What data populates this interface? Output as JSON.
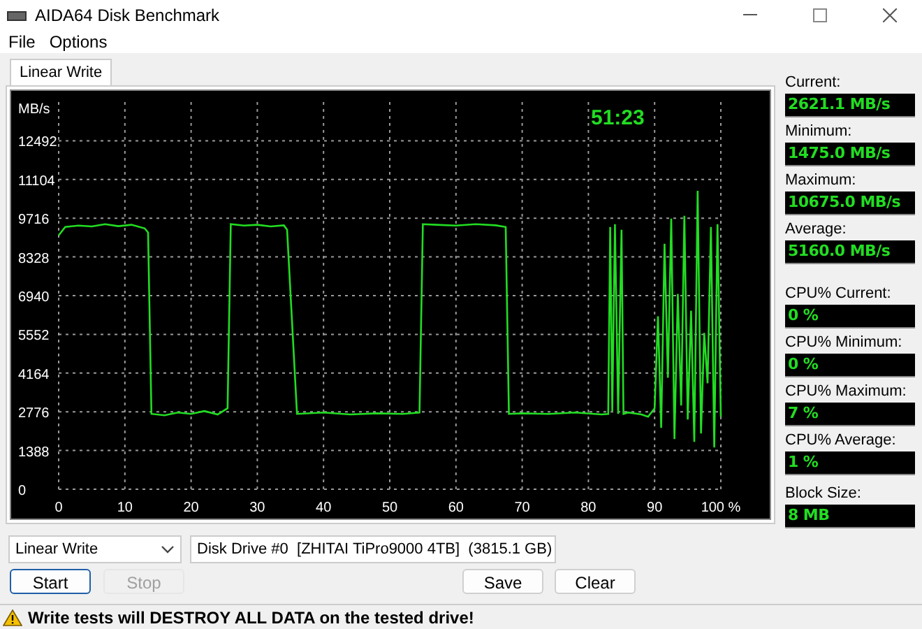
{
  "window": {
    "title": "AIDA64 Disk Benchmark"
  },
  "menu": [
    "File",
    "Options"
  ],
  "tabs": [
    {
      "label": "Linear Write",
      "selected": true
    }
  ],
  "chart": {
    "elapsed": "51:23",
    "chart_data": {
      "type": "line",
      "grid": true,
      "ylabel": "MB/s",
      "xlim": [
        0,
        100
      ],
      "ylim": [
        0,
        13880
      ],
      "xticks": [
        0,
        10,
        20,
        30,
        40,
        50,
        60,
        70,
        80,
        90,
        {
          "value": 100,
          "label": "100 %"
        }
      ],
      "yticks": [
        0,
        1388,
        2776,
        4164,
        5552,
        6940,
        8328,
        9716,
        11104,
        12492
      ],
      "x": [
        0,
        1,
        3,
        5,
        7,
        9,
        11,
        13,
        13.5,
        14,
        16,
        18,
        20,
        22,
        24,
        25.5,
        26,
        28,
        30,
        32,
        34,
        34.5,
        36,
        40,
        44,
        48,
        52,
        54.5,
        55,
        57,
        60,
        63,
        66,
        67.5,
        68,
        70,
        74,
        78,
        82,
        83,
        83.3,
        83.6,
        84,
        84.5,
        85,
        85.3,
        86,
        88,
        89,
        90,
        90.5,
        91,
        91.5,
        92,
        92.5,
        93,
        93.5,
        94,
        94.5,
        95,
        95.5,
        96,
        96.5,
        97,
        97.5,
        98,
        98.5,
        99,
        99.5,
        100
      ],
      "series": [
        {
          "color": "#22dd22",
          "values": [
            9100,
            9400,
            9450,
            9420,
            9500,
            9430,
            9480,
            9350,
            9200,
            2700,
            2650,
            2750,
            2700,
            2800,
            2680,
            2900,
            9500,
            9450,
            9480,
            9420,
            9460,
            9300,
            2700,
            2750,
            2680,
            2720,
            2700,
            2750,
            9500,
            9480,
            9450,
            9500,
            9460,
            9400,
            2700,
            2720,
            2700,
            2750,
            2680,
            2700,
            9400,
            2800,
            9500,
            2700,
            9300,
            2700,
            2750,
            2680,
            2600,
            2900,
            6200,
            2200,
            8800,
            4000,
            9700,
            1800,
            7000,
            3000,
            9800,
            2500,
            6400,
            1700,
            10700,
            2000,
            5600,
            3800,
            9400,
            1500,
            9500,
            2600
          ]
        }
      ]
    }
  },
  "stats": [
    {
      "label": "Current:",
      "value": "2621.1 MB/s"
    },
    {
      "label": "Minimum:",
      "value": "1475.0 MB/s"
    },
    {
      "label": "Maximum:",
      "value": "10675.0 MB/s"
    },
    {
      "label": "Average:",
      "value": "5160.0 MB/s"
    },
    {
      "label": "CPU% Current:",
      "value": "0 %"
    },
    {
      "label": "CPU% Minimum:",
      "value": "0 %"
    },
    {
      "label": "CPU% Maximum:",
      "value": "7 %"
    },
    {
      "label": "CPU% Average:",
      "value": "1 %"
    },
    {
      "label": "Block Size:",
      "value": "8 MB"
    }
  ],
  "test_select": {
    "value": "Linear Write"
  },
  "drive_select": {
    "value": "Disk Drive #0  [ZHITAI TiPro9000 4TB]  (3815.1 GB)"
  },
  "buttons": [
    {
      "label": "Start",
      "disabled": false,
      "selected": true
    },
    {
      "label": "Stop",
      "disabled": true,
      "selected": false
    },
    {
      "label": "Save",
      "disabled": false,
      "selected": false
    },
    {
      "label": "Clear",
      "disabled": false,
      "selected": false
    }
  ],
  "status_bar": {
    "warning": "Write tests will DESTROY ALL DATA on the tested drive!"
  }
}
